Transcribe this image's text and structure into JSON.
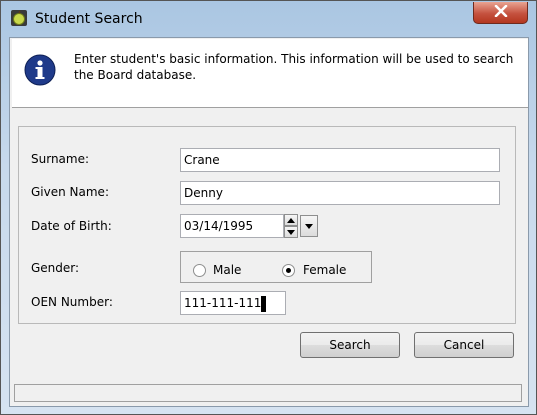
{
  "window": {
    "title": "Student Search",
    "close_label": "X"
  },
  "info": {
    "message": "Enter student's basic information. This information will be used to search the Board database."
  },
  "form": {
    "surname": {
      "label": "Surname:",
      "value": "Crane"
    },
    "given_name": {
      "label": "Given Name:",
      "value": "Denny"
    },
    "dob": {
      "label": "Date of Birth:",
      "value": "03/14/1995"
    },
    "gender": {
      "label": "Gender:",
      "options": [
        "Male",
        "Female"
      ],
      "selected": "Female"
    },
    "oen": {
      "label": "OEN Number:",
      "value": "111-111-111"
    }
  },
  "buttons": {
    "search": "Search",
    "cancel": "Cancel"
  },
  "colors": {
    "close_button": "#c5523f",
    "info_icon": "#1f3a8a"
  }
}
